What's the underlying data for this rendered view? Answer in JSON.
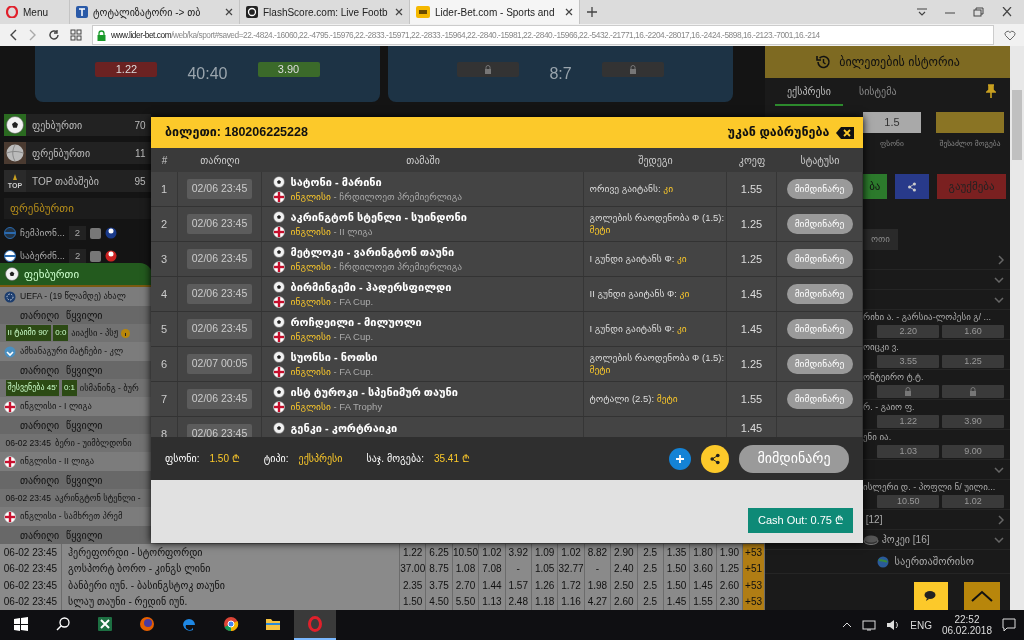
{
  "browser": {
    "tabs": [
      {
        "label": "Menu",
        "kind": "menu",
        "selected": false
      },
      {
        "label": "ტოტალიზატორი -> თბ",
        "kind": "page",
        "selected": false
      },
      {
        "label": "FlashScore.com: Live Footb",
        "kind": "page",
        "selected": false
      },
      {
        "label": "Lider-Bet.com - Sports and",
        "kind": "page",
        "selected": true
      }
    ],
    "url_host": "www.lider-bet.com",
    "url_rest": "/web/ka/sport#saved=22.-4824.-16060,22.-4795.-15976,22.-2833.-15971,22.-2833.-15964,22.-2840.-15981,22.-2840.-15966,22.-5432.-21771,16.-2204.-28017,16.-2424.-5898,16.-2123.-7001,16.-214"
  },
  "banner": [
    {
      "score": "40:40",
      "odds": [
        {
          "value": "1.22",
          "kind": "down"
        },
        {
          "value": "3.90",
          "kind": "up"
        }
      ]
    },
    {
      "score": "8:7",
      "odds": [
        {
          "kind": "locked"
        },
        {
          "kind": "locked"
        }
      ]
    }
  ],
  "sports": [
    {
      "name": "ფეხბურთი",
      "count": "70",
      "kind": "football"
    },
    {
      "name": "ფრენბურთი",
      "count": "11",
      "kind": "volleyball"
    },
    {
      "name": "TOP თამაშები",
      "count": "95",
      "kind": "top",
      "badge": "TOP"
    }
  ],
  "favorites": {
    "title": "ფრენბურთი",
    "items": [
      {
        "name": "ჩემპიონ...",
        "count": "2",
        "checked": false
      },
      {
        "name": "საბერძნ...",
        "count": "2",
        "checked": false
      }
    ]
  },
  "sport_tab": "ფეხბურთი",
  "sections": [
    {
      "title": "UEFA - (19 წლამდე) ახალ",
      "columns": [
        "თარიღი",
        "წყვილი"
      ],
      "rows": [
        {
          "kind": "live",
          "time": "II ტაიმი 90'",
          "score": "0:0",
          "match": "აიაქსი - პსჟ",
          "info": true
        }
      ]
    },
    {
      "title": "ამხანაგური მატჩები - კლ",
      "columns": [
        "თარიღი",
        "წყვილი"
      ],
      "rows": [
        {
          "kind": "live",
          "time": "შესვენება 45'",
          "score": "0:1",
          "match": "ისმანინგ - ბურ",
          "info": false
        }
      ]
    },
    {
      "title": "ინგლისი - I ლიგა",
      "columns": [
        "თარიღი",
        "წყვილი"
      ],
      "rows": [
        {
          "kind": "scheduled",
          "time": "06-02 23:45",
          "match": "ბერი - უიმბლდონი"
        }
      ]
    },
    {
      "title": "ინგლისი - II ლიგა",
      "columns": [
        "თარიღი",
        "წყვილი"
      ],
      "rows": [
        {
          "kind": "scheduled",
          "time": "06-02 23:45",
          "match": "აკრინგტონ სტენლი -"
        }
      ]
    },
    {
      "title": "ინგლისი - სამხრეთ პრემ",
      "columns": [
        "თარიღი",
        "წყვილი"
      ]
    }
  ],
  "odds_table": [
    {
      "date": "06-02 23:45",
      "match": "ჰერეფორდი - სტორფორდი",
      "odds": [
        "1.22",
        "6.25",
        "10.50",
        "1.02",
        "3.92",
        "1.09",
        "1.02",
        "8.82",
        "2.90",
        "2.5",
        "1.35",
        "1.80",
        "1.90"
      ],
      "more": "+53"
    },
    {
      "date": "06-02 23:45",
      "match": "გოსპორტ ბორო - კინგს ლინი",
      "odds": [
        "37.00",
        "8.75",
        "1.08",
        "7.08",
        "-",
        "1.05",
        "32.77",
        "-",
        "2.40",
        "2.5",
        "1.50",
        "3.60",
        "1.25"
      ],
      "more": "+51"
    },
    {
      "date": "06-02 23:45",
      "match": "ბანბერი იუნ. - ბასინგსტოკ თაუნი",
      "odds": [
        "2.35",
        "3.75",
        "2.70",
        "1.44",
        "1.57",
        "1.26",
        "1.72",
        "1.98",
        "2.50",
        "2.5",
        "1.50",
        "1.45",
        "2.60"
      ],
      "more": "+53"
    },
    {
      "date": "06-02 23:45",
      "match": "სლაუ თაუნი - რედინ იუნ.",
      "odds": [
        "1.50",
        "4.50",
        "5.50",
        "1.13",
        "2.48",
        "1.18",
        "1.16",
        "4.27",
        "2.60",
        "2.5",
        "1.45",
        "1.55",
        "2.30"
      ],
      "more": "+53"
    }
  ],
  "betslip": {
    "history_button": "ბილეთების ისტორია",
    "tabs": [
      {
        "label": "ექსპრესი",
        "selected": true
      },
      {
        "label": "სისტემა",
        "selected": false
      }
    ],
    "stake_value": "1.5",
    "stake_label": "ფსონი",
    "win_label": "შესაძლო მოგება",
    "buttons": [
      {
        "kind": "place",
        "label": "ბა"
      },
      {
        "kind": "share"
      },
      {
        "kind": "cancel",
        "label": "გაუქმება"
      }
    ]
  },
  "right_list": [
    {
      "kind": "tab",
      "label": "ოთი"
    },
    {
      "kind": "group",
      "expanded": false
    },
    {
      "kind": "group",
      "expanded": true
    },
    {
      "kind": "group",
      "expanded": true
    },
    {
      "kind": "event",
      "name": "რიხი ა. - გარსია-ლოპესი გ/ ...",
      "odds": [
        {
          "value": "2.20"
        },
        {
          "value": "1.60"
        }
      ]
    },
    {
      "kind": "event",
      "name": "ოიცკი ვ.",
      "odds": [
        {
          "value": "3.55"
        },
        {
          "value": "1.25"
        }
      ]
    },
    {
      "kind": "event",
      "name": "ონტეირო ტ.ტ.",
      "odds": [
        {
          "locked": true
        },
        {
          "locked": true
        }
      ]
    },
    {
      "kind": "event",
      "name": "რ. - გაიო ფ.",
      "odds": [
        {
          "value": "1.22"
        },
        {
          "value": "3.90"
        }
      ]
    },
    {
      "kind": "event",
      "name": "ენი ია.",
      "odds": [
        {
          "value": "1.03"
        },
        {
          "value": "9.00"
        }
      ]
    },
    {
      "kind": "group",
      "expanded": true
    },
    {
      "kind": "event",
      "name": "ისლერი დ. - პოფლი ნ/ უილი...",
      "odds": [
        {
          "value": "10.50"
        },
        {
          "value": "1.02"
        }
      ]
    },
    {
      "kind": "group",
      "label": "[12]",
      "expanded": false
    },
    {
      "kind": "sport",
      "label": "ჰოკეი [16]",
      "expanded": true
    },
    {
      "kind": "league",
      "label": "საერთაშორისო"
    }
  ],
  "ticket": {
    "title": "ბილეთი: 180206225228",
    "back": "უკან დაბრუნება",
    "columns": [
      "#",
      "თარიღი",
      "თამაში",
      "შედეგი",
      "კოეფ",
      "სტატუსი"
    ],
    "rows": [
      {
        "n": "1",
        "date": "02/06 23:45",
        "teams": "სატონი - მარინი",
        "country": "ინგლისი",
        "league": "- ჩრდილოეთ პრემიერლიგა",
        "bet": "ორივე გაიტანს:",
        "pick": "კი",
        "odds": "1.55",
        "status": "მიმდინარე"
      },
      {
        "n": "2",
        "date": "02/06 23:45",
        "teams": "აკრინგტონ სტენლი - სუინდონი",
        "country": "ინგლისი",
        "league": "- II ლიგა",
        "bet": "გოლების რაოდენობა Ф (1.5):",
        "pick": "მეტი",
        "odds": "1.25",
        "status": "მიმდინარე"
      },
      {
        "n": "3",
        "date": "02/06 23:45",
        "teams": "მეტლოკი - ვარინგტონ თაუნი",
        "country": "ინგლისი",
        "league": "- ჩრდილოეთ პრემიერლიგა",
        "bet": "I გუნდი გაიტანს Ф:",
        "pick": "კი",
        "odds": "1.25",
        "status": "მიმდინარე"
      },
      {
        "n": "4",
        "date": "02/06 23:45",
        "teams": "ბირმინგემი - ჰადერსფილდი",
        "country": "ინგლისი",
        "league": "- FA Cup.",
        "bet": "II გუნდი გაიტანს Ф:",
        "pick": "კი",
        "odds": "1.45",
        "status": "მიმდინარე"
      },
      {
        "n": "5",
        "date": "02/06 23:45",
        "teams": "როჩდეილი - მილუოლი",
        "country": "ინგლისი",
        "league": "- FA Cup.",
        "bet": "I გუნდი გაიტანს Ф:",
        "pick": "კი",
        "odds": "1.45",
        "status": "მიმდინარე"
      },
      {
        "n": "6",
        "date": "02/07 00:05",
        "teams": "სუონსი - ნოთსი",
        "country": "ინგლისი",
        "league": "- FA Cup.",
        "bet": "გოლების რაოდენობა Ф (1.5):",
        "pick": "მეტი",
        "odds": "1.25",
        "status": "მიმდინარე"
      },
      {
        "n": "7",
        "date": "02/06 23:45",
        "teams": "ისტ ტუროკი - სპენიმურ თაუნი",
        "country": "ინგლისი",
        "league": "- FA Trophy",
        "bet": "ტოტალი (2.5):",
        "pick": "მეტი",
        "odds": "1.55",
        "status": "მიმდინარე"
      },
      {
        "n": "8",
        "date": "02/06 23:45",
        "teams": "გენკი - კორტრაიკი",
        "odds": "1.45"
      }
    ],
    "summary": [
      {
        "label": "ფსონი:",
        "value": "1.50 ₾"
      },
      {
        "label": "ტიპი:",
        "value": "ექსპრესი"
      },
      {
        "label": "საჯ. მოგება:",
        "value": "35.41 ₾"
      }
    ],
    "state_button": "მიმდინარე",
    "cashout": "Cash Out: 0.75 ₾"
  },
  "taskbar": {
    "apps": [
      {
        "kind": "excel",
        "active": false
      },
      {
        "kind": "firefox",
        "active": false
      },
      {
        "kind": "edge",
        "active": false
      },
      {
        "kind": "chrome",
        "active": false
      },
      {
        "kind": "folder",
        "active": false
      },
      {
        "kind": "opera",
        "active": true
      }
    ],
    "lang": "ENG",
    "time": "22:52",
    "date": "06.02.2018"
  }
}
